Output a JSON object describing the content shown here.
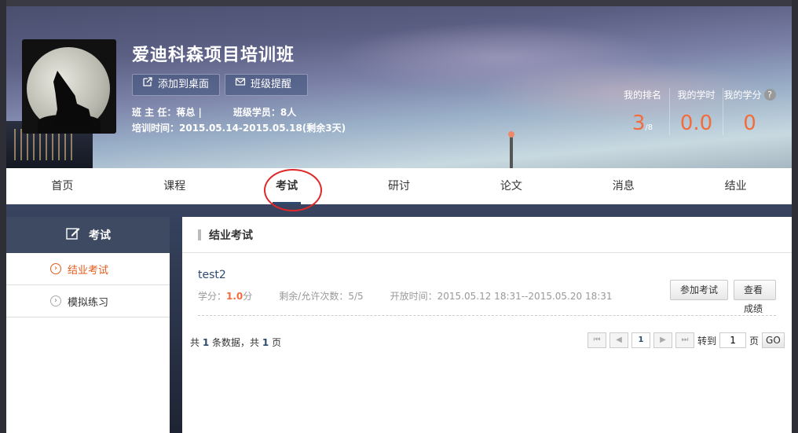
{
  "header": {
    "class_title": "爱迪科森项目培训班",
    "add_desktop_label": "添加到桌面",
    "remind_label": "班级提醒",
    "head_teacher": "班 主 任：蒋总 |",
    "members": "班级学员：8人",
    "training_time": "培训时间：2015.05.14-2015.05.18(剩余3天)",
    "stats": [
      {
        "label": "我的排名",
        "value": "3",
        "suffix": "/8"
      },
      {
        "label": "我的学时",
        "value": "0.0",
        "suffix": ""
      },
      {
        "label": "我的学分",
        "value": "0",
        "suffix": "",
        "help": "?"
      }
    ]
  },
  "nav": {
    "tabs": [
      "首页",
      "课程",
      "考试",
      "研讨",
      "论文",
      "消息",
      "结业"
    ],
    "active": "考试"
  },
  "sidebar": {
    "title": "考试",
    "items": [
      {
        "label": "结业考试",
        "active": true
      },
      {
        "label": "模拟练习",
        "active": false
      }
    ]
  },
  "main": {
    "title": "结业考试",
    "exams": [
      {
        "name": "test2",
        "credit_label": "学分：",
        "credit_value": "1.0",
        "credit_unit": "分",
        "attempts": "剩余/允许次数：5/5",
        "open_time": "开放时间：2015.05.12 18:31--2015.05.20 18:31",
        "join_label": "参加考试",
        "score_label": "查看成绩"
      }
    ],
    "pagination": {
      "prefix": "共",
      "total_records": "1",
      "records_label": "条数据，共",
      "total_pages": "1",
      "pages_label": "页",
      "first": "⏮",
      "prev": "◀",
      "current": "1",
      "next": "▶",
      "last": "⏭",
      "goto_label": "转到",
      "goto_value": "1",
      "page_unit": "页",
      "go_label": "GO"
    }
  },
  "colors": {
    "accent": "#f36c3c",
    "nav_dark": "#3d4a62",
    "link": "#2d4a6e",
    "highlight_circle": "#e0282a"
  }
}
